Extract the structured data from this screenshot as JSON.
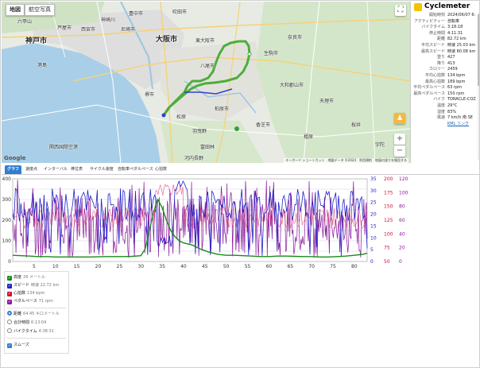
{
  "map": {
    "maptype_map": "地図",
    "maptype_satellite": "航空写真",
    "fullscreen_icon": "fullscreen-icon",
    "zoom_in": "+",
    "zoom_out": "−",
    "google": "Google",
    "attribution": "キーボード ショートカット　地図データ ©2024　利用規約　地図の誤りを報告する",
    "places": {
      "kobe": "神戸市",
      "osaka": "大阪市",
      "higashiosaka": "東大阪市",
      "yao": "八尾市",
      "amagasaki": "尼崎市",
      "nishinomiya": "西宮市",
      "toyonaka": "豊中市",
      "suita": "吹田市",
      "ashiya": "芦屋市",
      "sakai": "堺市",
      "kashiwara": "柏原市",
      "nara": "奈良市",
      "ikoma": "生駒市",
      "kashiba": "香芝市",
      "yamatokoriyama": "大和郡山市",
      "tenri": "天理市",
      "kanzaki": "神崎川",
      "rokko": "六甲山",
      "port": "港島",
      "tondabayashi": "富田林",
      "kawachinagano": "河内長野",
      "matsubara": "松原",
      "habikino": "羽曳野",
      "kashihara": "橿原",
      "sakurai": "桜井",
      "uda": "宇陀",
      "kix": "関西国際空港"
    }
  },
  "info": {
    "brand": "Cyclemeter",
    "rows": [
      {
        "k": "開始時刻",
        "v": "2024/06/07 6:"
      },
      {
        "k": "アクティビティー",
        "v": "自転車"
      },
      {
        "k": "バイクタイム",
        "v": "3:18:18"
      },
      {
        "k": "停止時間",
        "v": "4:11:31"
      },
      {
        "k": "距離",
        "v": "82.72 km"
      },
      {
        "k": "平均スピード",
        "v": "時速 25.03 km"
      },
      {
        "k": "最高スピード",
        "v": "時速 80.08 km"
      },
      {
        "k": "登り",
        "v": "427"
      },
      {
        "k": "降り",
        "v": "413"
      },
      {
        "k": "カロリー",
        "v": "2459"
      },
      {
        "k": "平均心拍数",
        "v": "134 bpm"
      },
      {
        "k": "最高心拍数",
        "v": "189 bpm"
      },
      {
        "k": "平均ペダルペース",
        "v": "63 rpm"
      },
      {
        "k": "最高ペダルペース",
        "v": "150 rpm"
      },
      {
        "k": "バイク",
        "v": "TORACLE-COZ"
      },
      {
        "k": "温度",
        "v": "29°C"
      },
      {
        "k": "湿度",
        "v": "83%"
      },
      {
        "k": "風速",
        "v": "7 km/h 南 SE"
      }
    ],
    "kml": "KML リンク"
  },
  "tabs": [
    "グラフ",
    "速度点",
    "インターバル",
    "棒位表",
    "サイクル速度",
    "自転車ペダルペース",
    "心拍数"
  ],
  "legend": {
    "elevation": {
      "label": "高度",
      "sub": "26 メートル"
    },
    "speed": {
      "label": "スピード",
      "sub": "時速 22.72 km"
    },
    "heart": {
      "label": "心拍数",
      "sub": "134 bpm"
    },
    "cadence": {
      "label": "ペダルペース",
      "sub": "71 rpm"
    },
    "distance": {
      "label": "距離",
      "sub": "64.45 キロメートル"
    },
    "total_time": {
      "label": "合計時間",
      "sub": "6:13:04"
    },
    "bike_time": {
      "label": "バイクタイム",
      "sub": "4:38:31"
    },
    "smooth": {
      "label": "スムーズ"
    }
  },
  "colors": {
    "elevation": "#1a8a1a",
    "speed": "#2020c8",
    "heart": "#d01030",
    "cadence": "#8a1a9a",
    "accent": "#2f7fd1"
  },
  "chart_data": {
    "type": "line",
    "x_ticks": [
      "5",
      "10",
      "15",
      "20",
      "25",
      "30",
      "35",
      "40",
      "45",
      "50",
      "55",
      "60",
      "65",
      "70",
      "75",
      "80"
    ],
    "xlim": [
      0,
      83
    ],
    "y_left_ticks": [
      "400",
      "300",
      "200",
      "100",
      "0"
    ],
    "y_left_lim": [
      0,
      400
    ],
    "y_right1_ticks": [
      "35",
      "30",
      "25",
      "20",
      "15",
      "10",
      "5",
      "0"
    ],
    "y_right1_lim": [
      0,
      35
    ],
    "y_right2_ticks": [
      "200",
      "175",
      "150",
      "125",
      "100",
      "75",
      "50"
    ],
    "y_right2_lim": [
      50,
      200
    ],
    "y_right3_ticks": [
      "120",
      "100",
      "80",
      "60",
      "40",
      "20",
      "0"
    ],
    "y_right3_lim": [
      0,
      120
    ],
    "series": [
      {
        "name": "高度",
        "axis": "left",
        "color": "#1a8a1a",
        "x": [
          0,
          2,
          4,
          6,
          8,
          10,
          14,
          18,
          22,
          26,
          28,
          30,
          31,
          32,
          33,
          34,
          35,
          36,
          37,
          38,
          39,
          40,
          42,
          44,
          46,
          48,
          50,
          52,
          54,
          56,
          58,
          60,
          62,
          64,
          66,
          68,
          70,
          72,
          74,
          76,
          78,
          80,
          82,
          83
        ],
        "y": [
          30,
          28,
          26,
          24,
          24,
          22,
          22,
          22,
          24,
          24,
          25,
          28,
          60,
          150,
          240,
          300,
          260,
          200,
          150,
          120,
          100,
          90,
          80,
          60,
          45,
          35,
          30,
          30,
          28,
          26,
          24,
          24,
          26,
          26,
          25,
          24,
          24,
          22,
          22,
          24,
          26,
          30,
          35,
          40
        ]
      }
    ]
  }
}
